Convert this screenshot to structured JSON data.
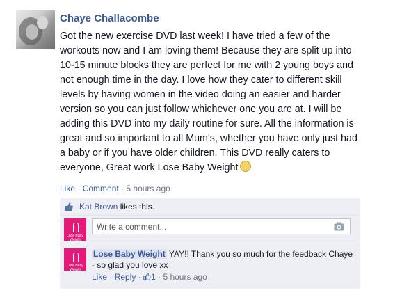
{
  "post": {
    "author": "Chaye Challacombe",
    "text": "Got the new exercise DVD last week! I have tried a few of the workouts now and I am loving them! Because they are split up into 10-15 minute blocks they are perfect for me with 2 young boys and not enough time in the day. I love how they cater to different skill levels by having women in the video doing an easier and harder version so you can just follow whichever one you are at. I will be adding this DVD into my daily routine for sure. All the information is great and so important to all Mum's, whether you have only just had a baby or if you have older children. This DVD really caters to everyone, Great work Lose Baby Weight",
    "like_label": "Like",
    "comment_label": "Comment",
    "separator": "·",
    "time": "5 hours ago"
  },
  "likes": {
    "name": "Kat Brown",
    "suffix": " likes this."
  },
  "write_comment": {
    "placeholder": "Write a comment..."
  },
  "reply": {
    "author": "Lose Baby Weight",
    "text": " YAY!! Thank you so much for the feedback Chaye - so glad you love xx",
    "like_label": "Like",
    "reply_label": "Reply",
    "like_count": "1",
    "time": "5 hours ago"
  },
  "page_avatar": {
    "brand": "Lose Baby Weight"
  },
  "icons": {
    "smiley": "smiley-emoticon-icon",
    "thumb": "thumbs-up-icon",
    "camera": "camera-icon"
  },
  "colors": {
    "link": "#3b5998",
    "comments_bg": "#edeff4",
    "brand_pink": "#e5197a"
  }
}
